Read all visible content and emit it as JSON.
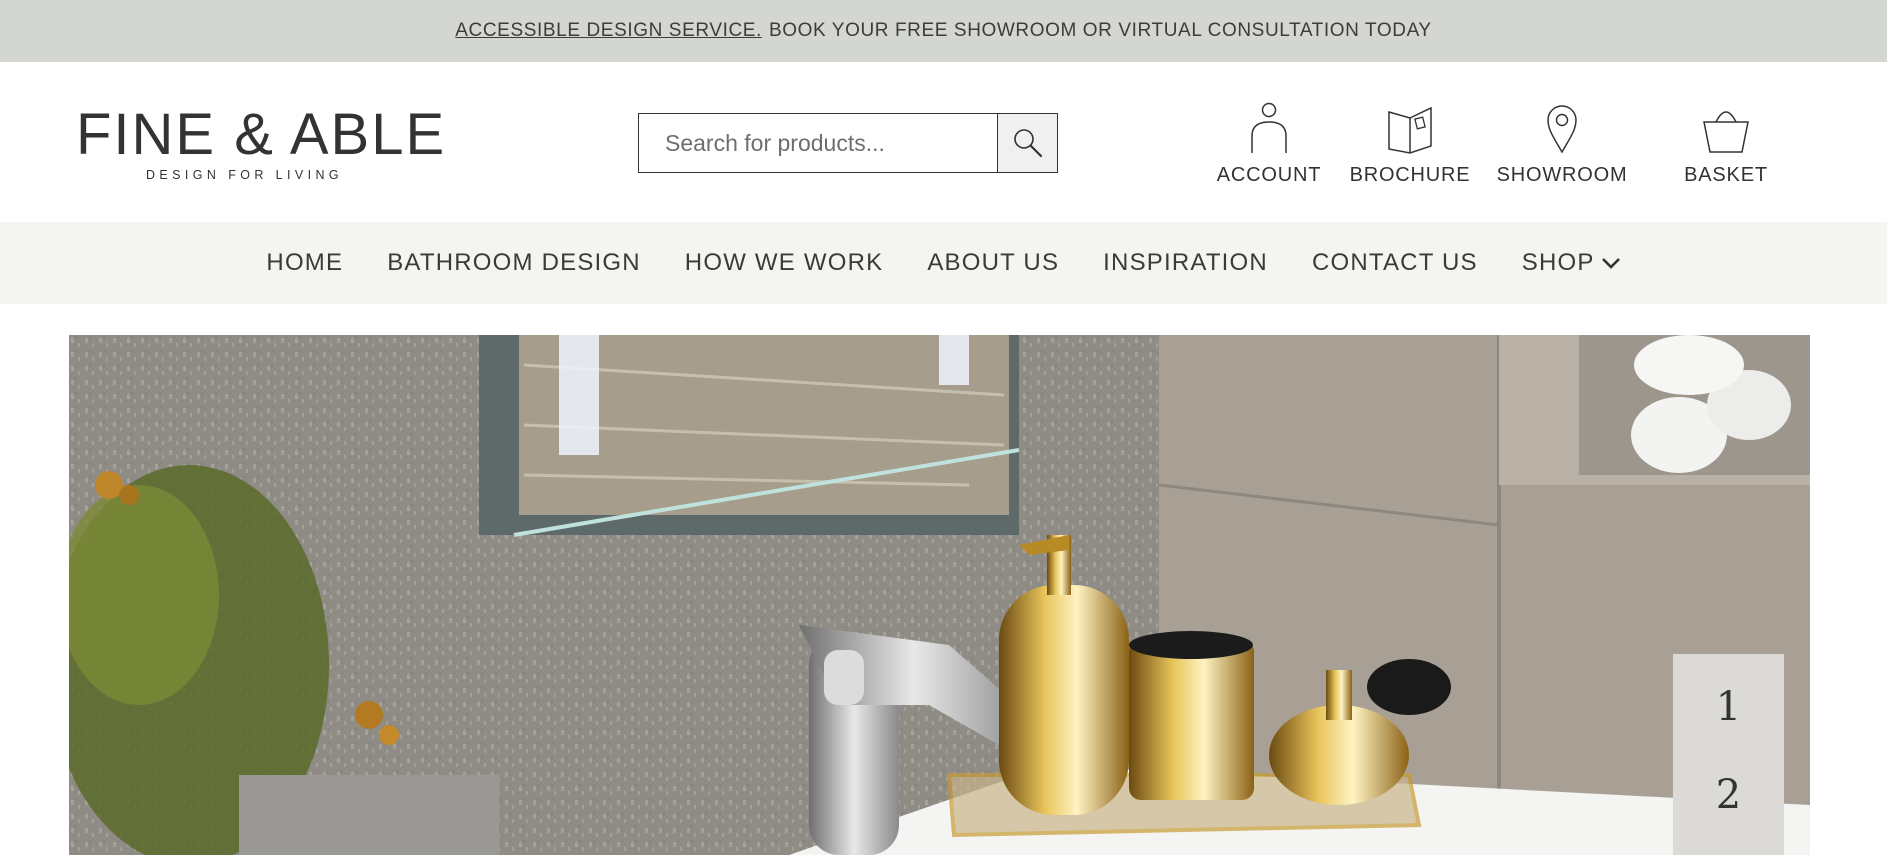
{
  "announcement": {
    "link_text": "ACCESSIBLE DESIGN SERVICE.",
    "text": "BOOK YOUR FREE SHOWROOM OR VIRTUAL CONSULTATION TODAY"
  },
  "logo": {
    "name": "FINE & ABLE",
    "tagline": "DESIGN FOR LIVING"
  },
  "search": {
    "placeholder": "Search for products...",
    "icon": "search-icon"
  },
  "utility_links": [
    {
      "label": "ACCOUNT",
      "icon": "user-icon"
    },
    {
      "label": "BROCHURE",
      "icon": "book-icon"
    },
    {
      "label": "SHOWROOM",
      "icon": "location-pin-icon"
    },
    {
      "label": "BASKET",
      "icon": "basket-icon"
    }
  ],
  "nav": {
    "items": [
      {
        "label": "HOME"
      },
      {
        "label": "BATHROOM DESIGN"
      },
      {
        "label": "HOW WE WORK"
      },
      {
        "label": "ABOUT US"
      },
      {
        "label": "INSPIRATION"
      },
      {
        "label": "CONTACT US"
      },
      {
        "label": "SHOP",
        "icon": "chevron-down-icon"
      }
    ]
  },
  "hero": {
    "slides": [
      "1",
      "2"
    ]
  },
  "colors": {
    "announcement_bg": "#d3d6d1",
    "nav_bg": "#f4f5f0",
    "text": "#3a3a3a"
  }
}
